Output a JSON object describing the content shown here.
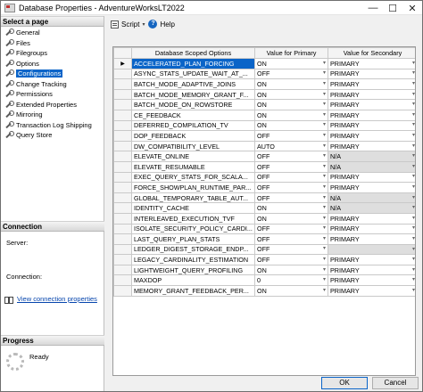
{
  "window": {
    "title": "Database Properties - AdventureWorksLT2022",
    "minimize_glyph": "—",
    "maximize_glyph": "☐",
    "close_glyph": "✕"
  },
  "left": {
    "select_page_heading": "Select a page",
    "pages": [
      {
        "label": "General",
        "selected": false
      },
      {
        "label": "Files",
        "selected": false
      },
      {
        "label": "Filegroups",
        "selected": false
      },
      {
        "label": "Options",
        "selected": false
      },
      {
        "label": "Configurations",
        "selected": true
      },
      {
        "label": "Change Tracking",
        "selected": false
      },
      {
        "label": "Permissions",
        "selected": false
      },
      {
        "label": "Extended Properties",
        "selected": false
      },
      {
        "label": "Mirroring",
        "selected": false
      },
      {
        "label": "Transaction Log Shipping",
        "selected": false
      },
      {
        "label": "Query Store",
        "selected": false
      }
    ],
    "connection_heading": "Connection",
    "server_label": "Server:",
    "connection_label": "Connection:",
    "view_connection_link": "View connection properties",
    "progress_heading": "Progress",
    "progress_status": "Ready"
  },
  "toolbar": {
    "script_label": "Script",
    "script_dropdown_glyph": "▾",
    "help_label": "Help",
    "help_glyph": "?"
  },
  "grid": {
    "headers": [
      "",
      "Database Scoped Options",
      "Value for Primary",
      "Value for Secondary"
    ],
    "current_row_glyph": "▶",
    "rows": [
      {
        "name": "ACCELERATED_PLAN_FORCING",
        "primary": "ON",
        "secondary": "PRIMARY",
        "selected": true,
        "secondary_gray": false
      },
      {
        "name": "ASYNC_STATS_UPDATE_WAIT_AT_...",
        "primary": "OFF",
        "secondary": "PRIMARY",
        "selected": false,
        "secondary_gray": false
      },
      {
        "name": "BATCH_MODE_ADAPTIVE_JOINS",
        "primary": "ON",
        "secondary": "PRIMARY",
        "selected": false,
        "secondary_gray": false
      },
      {
        "name": "BATCH_MODE_MEMORY_GRANT_F...",
        "primary": "ON",
        "secondary": "PRIMARY",
        "selected": false,
        "secondary_gray": false
      },
      {
        "name": "BATCH_MODE_ON_ROWSTORE",
        "primary": "ON",
        "secondary": "PRIMARY",
        "selected": false,
        "secondary_gray": false
      },
      {
        "name": "CE_FEEDBACK",
        "primary": "ON",
        "secondary": "PRIMARY",
        "selected": false,
        "secondary_gray": false
      },
      {
        "name": "DEFERRED_COMPILATION_TV",
        "primary": "ON",
        "secondary": "PRIMARY",
        "selected": false,
        "secondary_gray": false
      },
      {
        "name": "DOP_FEEDBACK",
        "primary": "OFF",
        "secondary": "PRIMARY",
        "selected": false,
        "secondary_gray": false
      },
      {
        "name": "DW_COMPATIBILITY_LEVEL",
        "primary": "AUTO",
        "secondary": "PRIMARY",
        "selected": false,
        "secondary_gray": false
      },
      {
        "name": "ELEVATE_ONLINE",
        "primary": "OFF",
        "secondary": "N/A",
        "selected": false,
        "secondary_gray": true
      },
      {
        "name": "ELEVATE_RESUMABLE",
        "primary": "OFF",
        "secondary": "N/A",
        "selected": false,
        "secondary_gray": true
      },
      {
        "name": "EXEC_QUERY_STATS_FOR_SCALA...",
        "primary": "OFF",
        "secondary": "PRIMARY",
        "selected": false,
        "secondary_gray": false
      },
      {
        "name": "FORCE_SHOWPLAN_RUNTIME_PAR...",
        "primary": "OFF",
        "secondary": "PRIMARY",
        "selected": false,
        "secondary_gray": false
      },
      {
        "name": "GLOBAL_TEMPORARY_TABLE_AUT...",
        "primary": "OFF",
        "secondary": "N/A",
        "selected": false,
        "secondary_gray": true
      },
      {
        "name": "IDENTITY_CACHE",
        "primary": "ON",
        "secondary": "N/A",
        "selected": false,
        "secondary_gray": true
      },
      {
        "name": "INTERLEAVED_EXECUTION_TVF",
        "primary": "ON",
        "secondary": "PRIMARY",
        "selected": false,
        "secondary_gray": false
      },
      {
        "name": "ISOLATE_SECURITY_POLICY_CARDI...",
        "primary": "OFF",
        "secondary": "PRIMARY",
        "selected": false,
        "secondary_gray": false
      },
      {
        "name": "LAST_QUERY_PLAN_STATS",
        "primary": "OFF",
        "secondary": "PRIMARY",
        "selected": false,
        "secondary_gray": false
      },
      {
        "name": "LEDGER_DIGEST_STORAGE_ENDP...",
        "primary": "OFF",
        "secondary": "",
        "selected": false,
        "secondary_gray": true
      },
      {
        "name": "LEGACY_CARDINALITY_ESTIMATION",
        "primary": "OFF",
        "secondary": "PRIMARY",
        "selected": false,
        "secondary_gray": false
      },
      {
        "name": "LIGHTWEIGHT_QUERY_PROFILING",
        "primary": "ON",
        "secondary": "PRIMARY",
        "selected": false,
        "secondary_gray": false
      },
      {
        "name": "MAXDOP",
        "primary": "0",
        "secondary": "PRIMARY",
        "selected": false,
        "secondary_gray": false
      },
      {
        "name": "MEMORY_GRANT_FEEDBACK_PER...",
        "primary": "ON",
        "secondary": "PRIMARY",
        "selected": false,
        "secondary_gray": false
      }
    ]
  },
  "buttons": {
    "ok": "OK",
    "cancel": "Cancel"
  }
}
